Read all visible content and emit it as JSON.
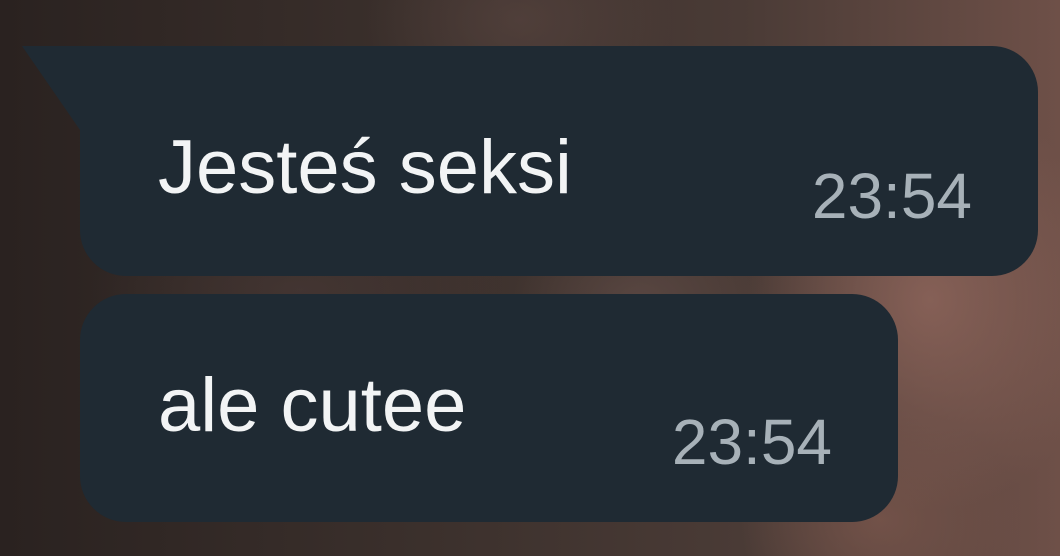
{
  "chat": {
    "messages": [
      {
        "text": "Jesteś seksi",
        "time": "23:54"
      },
      {
        "text": "ale cutee",
        "time": "23:54"
      }
    ]
  },
  "colors": {
    "bubble_background": "#1f2a33",
    "message_text": "#f2f4f5",
    "timestamp_text": "#a7b1b8"
  }
}
